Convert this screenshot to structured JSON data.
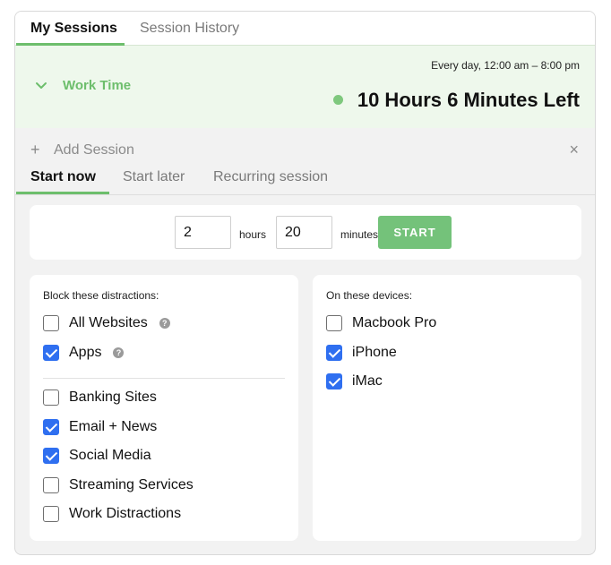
{
  "tabs": [
    {
      "label": "My Sessions",
      "active": true
    },
    {
      "label": "Session History",
      "active": false
    }
  ],
  "session": {
    "name": "Work Time",
    "schedule": "Every day, 12:00 am – 8:00 pm",
    "remaining": "10 Hours 6 Minutes Left",
    "status_color": "#7ec87d"
  },
  "add_session": {
    "label": "Add Session",
    "plus_icon": "+",
    "close_icon": "×"
  },
  "sub_tabs": [
    {
      "label": "Start now",
      "active": true
    },
    {
      "label": "Start later",
      "active": false
    },
    {
      "label": "Recurring session",
      "active": false
    }
  ],
  "timer": {
    "hours_value": "2",
    "hours_label": "hours",
    "minutes_value": "20",
    "minutes_label": "minutes",
    "start_label": "START"
  },
  "block": {
    "title": "Block these distractions:",
    "top_items": [
      {
        "label": "All Websites",
        "checked": false,
        "help": true
      },
      {
        "label": "Apps",
        "checked": true,
        "help": true
      }
    ],
    "items": [
      {
        "label": "Banking Sites",
        "checked": false
      },
      {
        "label": "Email + News",
        "checked": true
      },
      {
        "label": "Social Media",
        "checked": true
      },
      {
        "label": "Streaming Services",
        "checked": false
      },
      {
        "label": "Work Distractions",
        "checked": false
      }
    ]
  },
  "devices": {
    "title": "On these devices:",
    "items": [
      {
        "label": "Macbook Pro",
        "checked": false
      },
      {
        "label": "iPhone",
        "checked": true
      },
      {
        "label": "iMac",
        "checked": true
      }
    ]
  },
  "colors": {
    "accent": "#6dbe6c",
    "start_button": "#74c27a",
    "checkbox": "#2f6ff0",
    "session_bg": "#eef8ec"
  },
  "icons": {
    "help": "?"
  }
}
